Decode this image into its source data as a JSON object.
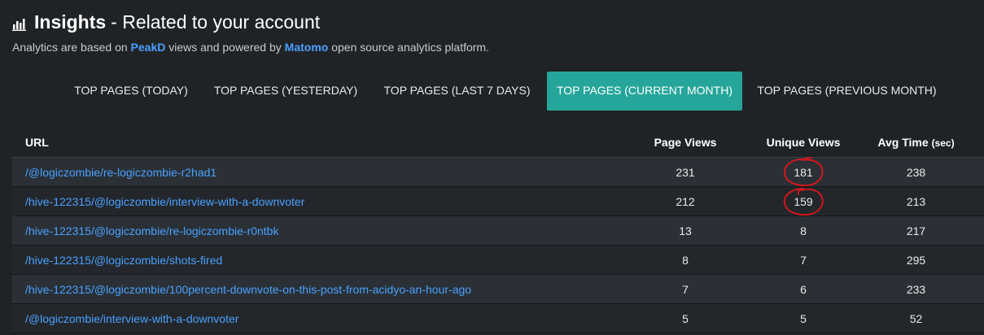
{
  "header": {
    "title_strong": "Insights",
    "title_rest": "- Related to your account",
    "icon": "bar-chart-icon"
  },
  "subtitle": {
    "prefix": "Analytics are based on ",
    "link1": "PeakD",
    "middle": " views and powered by ",
    "link2": "Matomo",
    "suffix": " open source analytics platform."
  },
  "tabs": [
    {
      "label": "TOP PAGES (TODAY)",
      "active": false
    },
    {
      "label": "TOP PAGES (YESTERDAY)",
      "active": false
    },
    {
      "label": "TOP PAGES (LAST 7 DAYS)",
      "active": false
    },
    {
      "label": "TOP PAGES (CURRENT MONTH)",
      "active": true
    },
    {
      "label": "TOP PAGES (PREVIOUS MONTH)",
      "active": false
    }
  ],
  "table": {
    "headers": {
      "url": "URL",
      "page_views": "Page Views",
      "unique_views": "Unique Views",
      "avg_time": "Avg Time",
      "avg_time_unit": "(sec)"
    },
    "rows": [
      {
        "url": "/@logiczombie/re-logiczombie-r2had1",
        "page_views": "231",
        "unique_views": "181",
        "avg_time": "238"
      },
      {
        "url": "/hive-122315/@logiczombie/interview-with-a-downvoter",
        "page_views": "212",
        "unique_views": "159",
        "avg_time": "213"
      },
      {
        "url": "/hive-122315/@logiczombie/re-logiczombie-r0ntbk",
        "page_views": "13",
        "unique_views": "8",
        "avg_time": "217"
      },
      {
        "url": "/hive-122315/@logiczombie/shots-fired",
        "page_views": "8",
        "unique_views": "7",
        "avg_time": "295"
      },
      {
        "url": "/hive-122315/@logiczombie/100percent-downvote-on-this-post-from-acidyo-an-hour-ago",
        "page_views": "7",
        "unique_views": "6",
        "avg_time": "233"
      },
      {
        "url": "/@logiczombie/interview-with-a-downvoter",
        "page_views": "5",
        "unique_views": "5",
        "avg_time": "52"
      }
    ]
  },
  "colors": {
    "background": "#202326",
    "accent": "#26a69a",
    "link": "#4aa0ff",
    "annotation": "#e0151b"
  }
}
